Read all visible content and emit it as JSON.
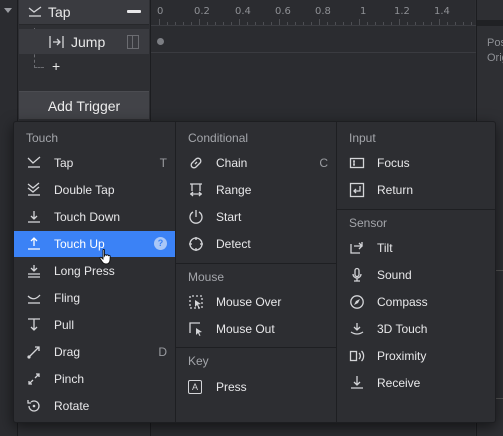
{
  "layers": {
    "rows": [
      {
        "label": "Tap"
      },
      {
        "label": "Jump"
      }
    ],
    "plus_label": "+",
    "add_trigger_label": "Add Trigger"
  },
  "timeline": {
    "ticks": [
      "0",
      "0.2",
      "0.4",
      "0.6",
      "0.8",
      "1",
      "1.2",
      "1.4"
    ]
  },
  "right_panel": {
    "text1": "Pos",
    "text2": "Orig"
  },
  "menu": {
    "touch": {
      "title": "Touch",
      "items": [
        {
          "label": "Tap",
          "shortcut": "T",
          "icon": "tap-icon"
        },
        {
          "label": "Double Tap",
          "shortcut": "",
          "icon": "double-tap-icon"
        },
        {
          "label": "Touch Down",
          "shortcut": "",
          "icon": "touch-down-icon"
        },
        {
          "label": "Touch Up",
          "shortcut": "",
          "icon": "touch-up-icon",
          "help": "?"
        },
        {
          "label": "Long Press",
          "shortcut": "",
          "icon": "long-press-icon"
        },
        {
          "label": "Fling",
          "shortcut": "",
          "icon": "fling-icon"
        },
        {
          "label": "Pull",
          "shortcut": "",
          "icon": "pull-icon"
        },
        {
          "label": "Drag",
          "shortcut": "D",
          "icon": "drag-icon"
        },
        {
          "label": "Pinch",
          "shortcut": "",
          "icon": "pinch-icon"
        },
        {
          "label": "Rotate",
          "shortcut": "",
          "icon": "rotate-icon"
        }
      ]
    },
    "conditional": {
      "title": "Conditional",
      "items": [
        {
          "label": "Chain",
          "shortcut": "C",
          "icon": "chain-icon"
        },
        {
          "label": "Range",
          "shortcut": "",
          "icon": "range-icon"
        },
        {
          "label": "Start",
          "shortcut": "",
          "icon": "start-icon"
        },
        {
          "label": "Detect",
          "shortcut": "",
          "icon": "detect-icon"
        }
      ]
    },
    "mouse": {
      "title": "Mouse",
      "items": [
        {
          "label": "Mouse Over",
          "icon": "mouse-over-icon"
        },
        {
          "label": "Mouse Out",
          "icon": "mouse-out-icon"
        }
      ]
    },
    "key": {
      "title": "Key",
      "items": [
        {
          "label": "Press",
          "icon": "key-press-icon",
          "glyph": "A"
        }
      ]
    },
    "input": {
      "title": "Input",
      "items": [
        {
          "label": "Focus",
          "icon": "focus-icon"
        },
        {
          "label": "Return",
          "icon": "return-icon"
        }
      ]
    },
    "sensor": {
      "title": "Sensor",
      "items": [
        {
          "label": "Tilt",
          "icon": "tilt-icon"
        },
        {
          "label": "Sound",
          "icon": "sound-icon"
        },
        {
          "label": "Compass",
          "icon": "compass-icon"
        },
        {
          "label": "3D Touch",
          "icon": "3d-touch-icon"
        },
        {
          "label": "Proximity",
          "icon": "proximity-icon"
        },
        {
          "label": "Receive",
          "icon": "receive-icon"
        }
      ]
    }
  },
  "colors": {
    "accent": "#3b82f6",
    "background": "#2e2f33",
    "menu_bg": "#2d2e32"
  }
}
